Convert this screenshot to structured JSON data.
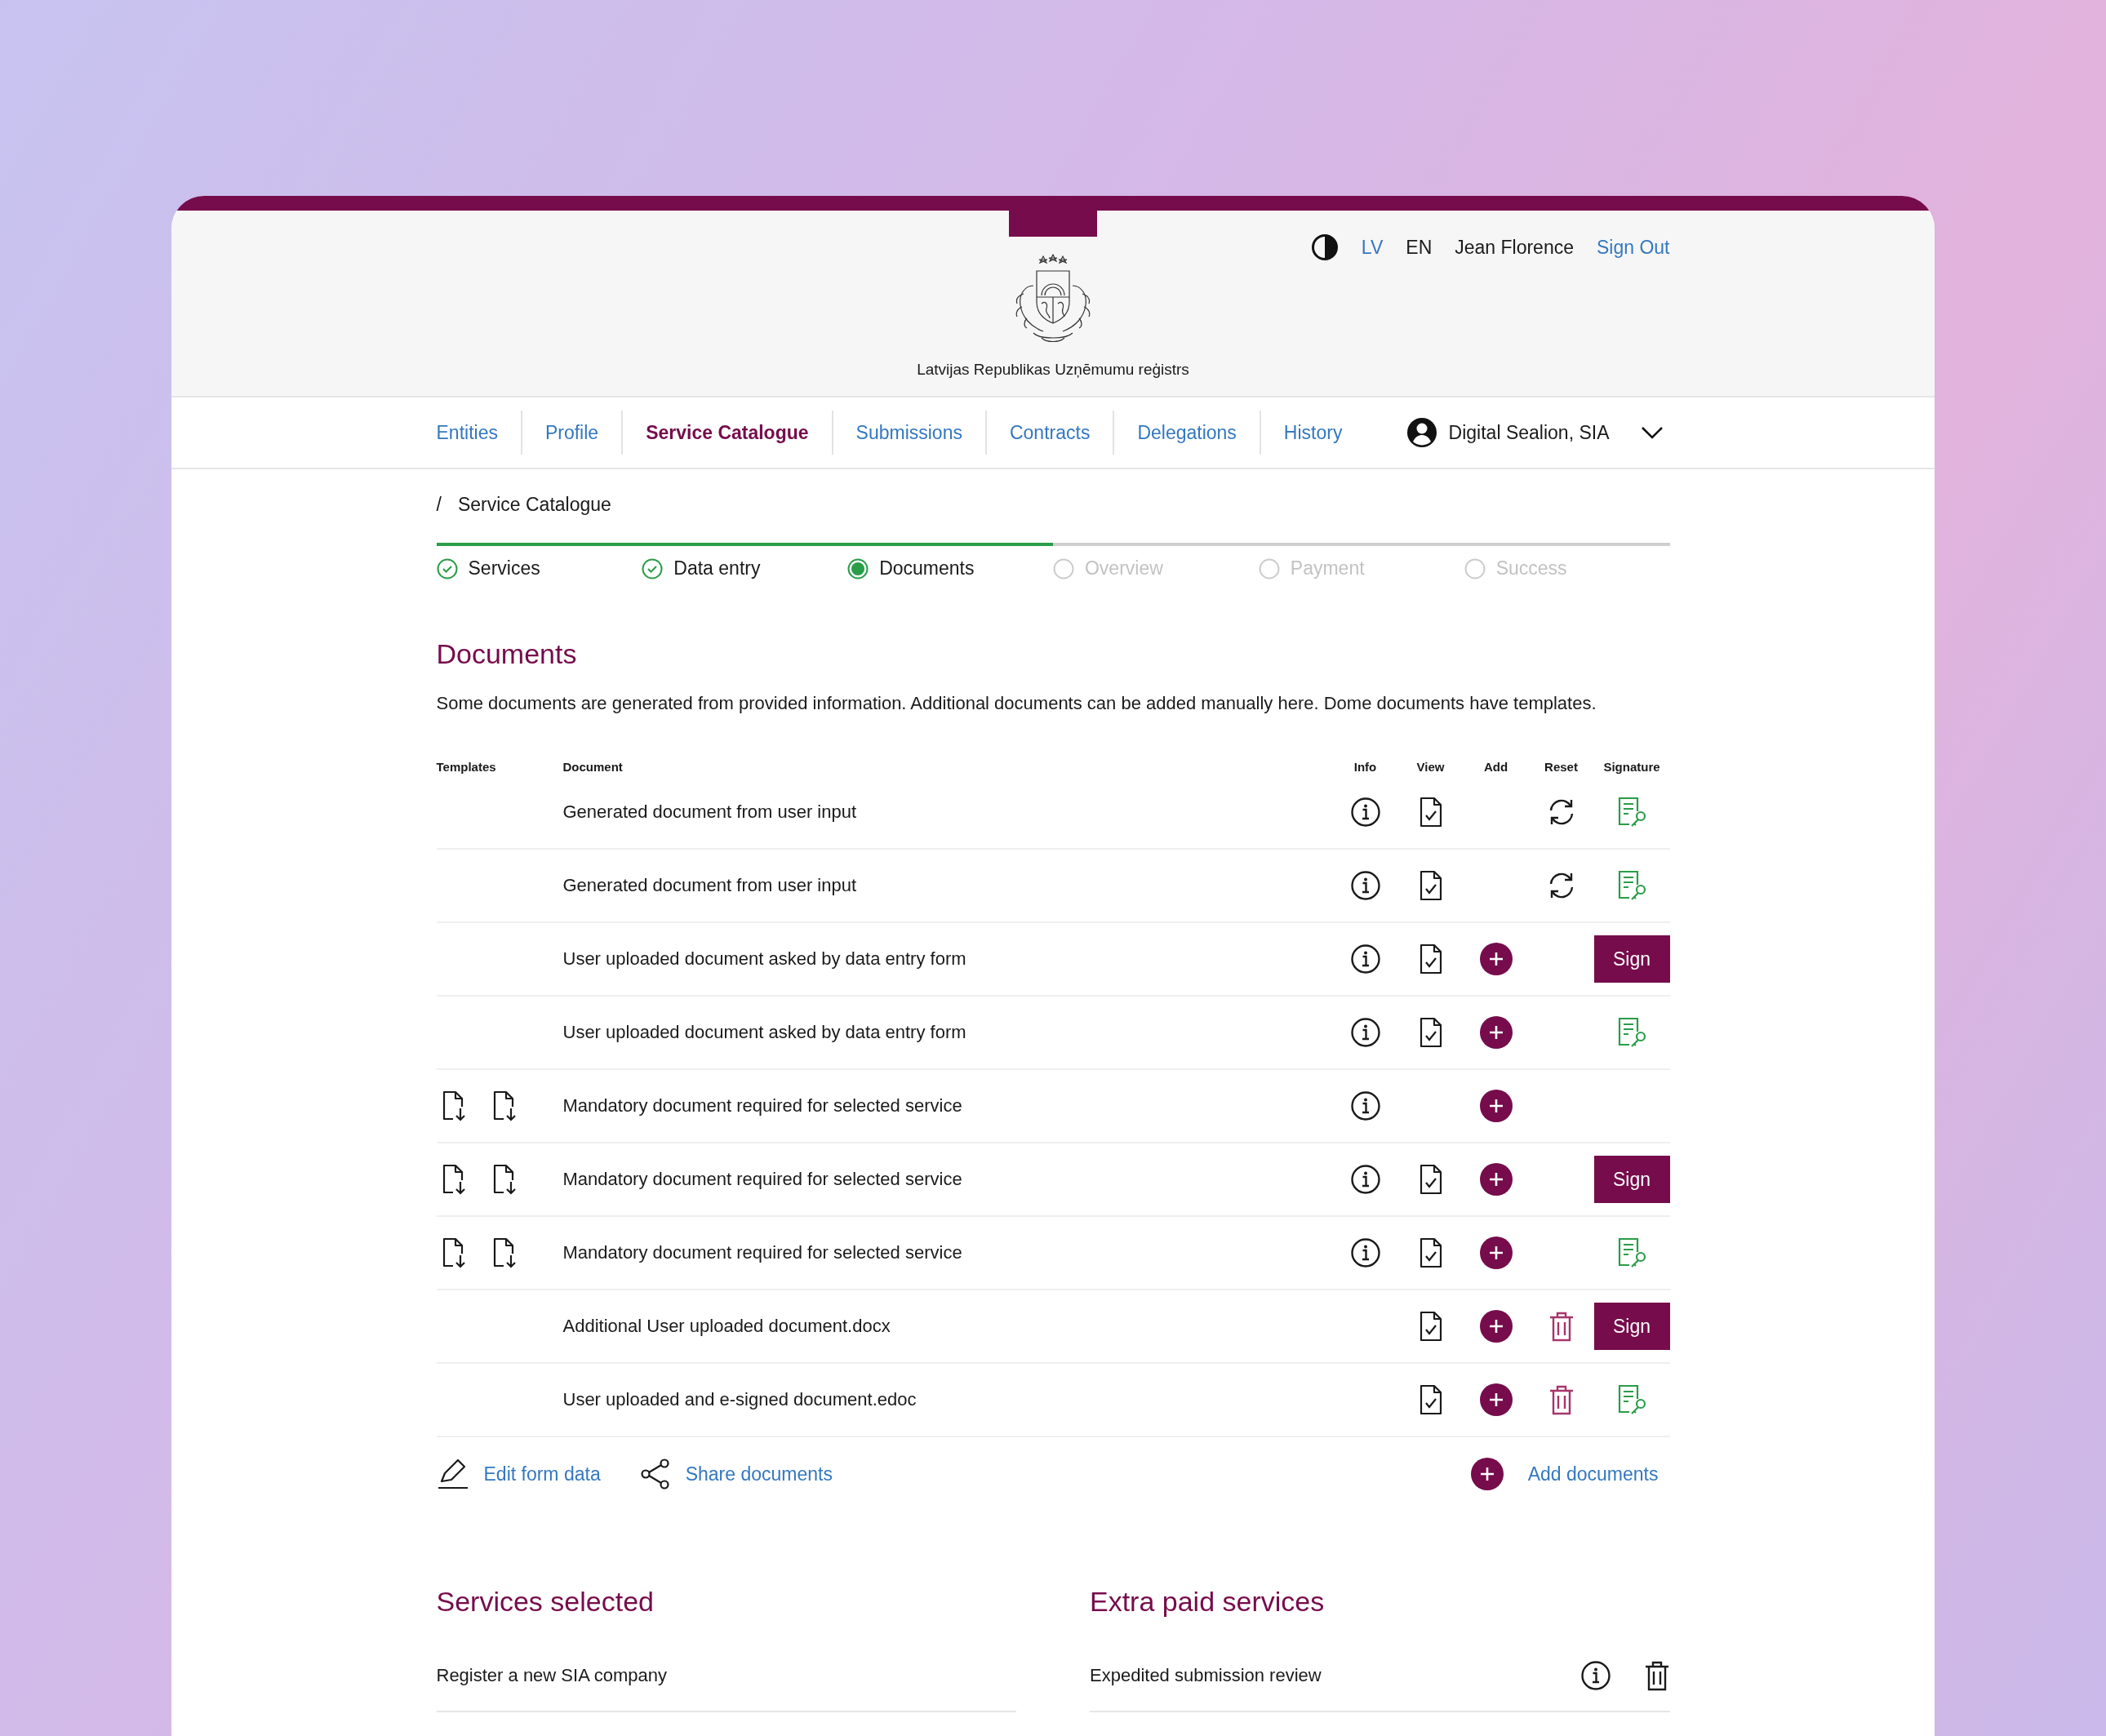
{
  "header": {
    "org_name": "Latvijas Republikas Uzņēmumu reģistrs",
    "languages": [
      {
        "label": "LV",
        "selected": false
      },
      {
        "label": "EN",
        "selected": true
      }
    ],
    "user": "Jean Florence",
    "sign_out": "Sign Out"
  },
  "nav": {
    "tabs": [
      {
        "label": "Entities",
        "selected": false
      },
      {
        "label": "Profile",
        "selected": false
      },
      {
        "label": "Service Catalogue",
        "selected": true
      },
      {
        "label": "Submissions",
        "selected": false
      },
      {
        "label": "Contracts",
        "selected": false
      },
      {
        "label": "Delegations",
        "selected": false
      },
      {
        "label": "History",
        "selected": false
      }
    ],
    "account": "Digital Sealion, SIA"
  },
  "breadcrumb": {
    "separator": "/",
    "current": "Service Catalogue"
  },
  "stepper": {
    "level": 0.5,
    "steps": [
      {
        "label": "Services",
        "done": true,
        "selected": false
      },
      {
        "label": "Data entry",
        "done": true,
        "selected": false
      },
      {
        "label": "Documents",
        "done": false,
        "selected": true
      },
      {
        "label": "Overview",
        "done": false,
        "selected": false
      },
      {
        "label": "Payment",
        "done": false,
        "selected": false
      },
      {
        "label": "Success",
        "done": false,
        "selected": false
      }
    ]
  },
  "documents": {
    "title": "Documents",
    "description": "Some documents are generated from provided information. Additional documents can be added manually here. Dome documents have templates.",
    "columns": [
      "Templates",
      "Document",
      "Info",
      "View",
      "Add",
      "Reset",
      "Signature"
    ],
    "rows": [
      {
        "templates": false,
        "name": "Generated document from user input",
        "info": true,
        "view": true,
        "add": false,
        "reset": true,
        "delete": false,
        "signature": {
          "kind": "signed"
        }
      },
      {
        "templates": false,
        "name": "Generated document from user input",
        "info": true,
        "view": true,
        "add": false,
        "reset": true,
        "delete": false,
        "signature": {
          "kind": "signed"
        }
      },
      {
        "templates": false,
        "name": "User uploaded document asked by data entry form",
        "info": true,
        "view": true,
        "add": true,
        "reset": false,
        "delete": false,
        "signature": {
          "kind": "button",
          "label": "Sign"
        }
      },
      {
        "templates": false,
        "name": "User uploaded document asked by data entry form",
        "info": true,
        "view": true,
        "add": true,
        "reset": false,
        "delete": false,
        "signature": {
          "kind": "signed"
        }
      },
      {
        "templates": true,
        "name": "Mandatory document required for selected service",
        "info": true,
        "view": false,
        "add": true,
        "reset": false,
        "delete": false
      },
      {
        "templates": true,
        "name": "Mandatory document required for selected service",
        "info": true,
        "view": true,
        "add": true,
        "reset": false,
        "delete": false,
        "signature": {
          "kind": "button",
          "label": "Sign"
        }
      },
      {
        "templates": true,
        "name": "Mandatory document required for selected service",
        "info": true,
        "view": true,
        "add": true,
        "reset": false,
        "delete": false,
        "signature": {
          "kind": "signed"
        }
      },
      {
        "templates": false,
        "name": "Additional User uploaded document.docx",
        "info": false,
        "view": true,
        "add": true,
        "reset": false,
        "delete": true,
        "signature": {
          "kind": "button",
          "label": "Sign"
        }
      },
      {
        "templates": false,
        "name": "User uploaded and e-signed document.edoc",
        "info": false,
        "view": true,
        "add": true,
        "reset": false,
        "delete": true,
        "signature": {
          "kind": "signed"
        }
      }
    ],
    "actions": {
      "edit": "Edit form data",
      "share": "Share documents",
      "add": "Add documents"
    }
  },
  "services_selected": {
    "title": "Services selected",
    "items": [
      "Register a new SIA company"
    ]
  },
  "extra_services": {
    "title": "Extra paid services",
    "items": [
      "Expedited submission review"
    ]
  }
}
